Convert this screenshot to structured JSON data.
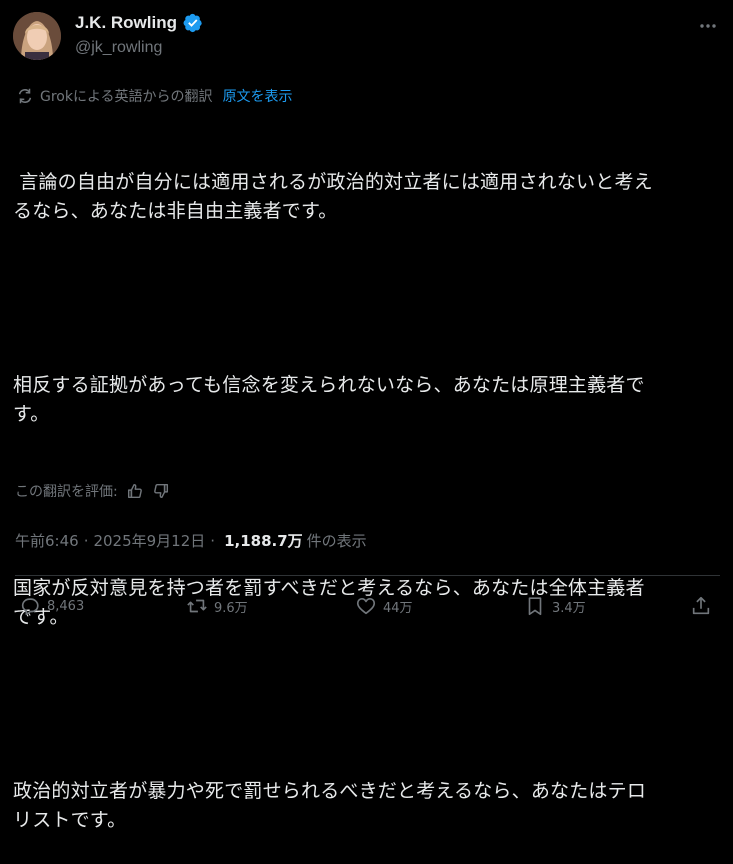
{
  "author": {
    "display_name": "J.K. Rowling",
    "handle": "@jk_rowling",
    "verified": true
  },
  "icons": {
    "more": "more-horizontal-icon",
    "translate": "translate-icon",
    "thumbs_up": "thumbs-up-icon",
    "thumbs_down": "thumbs-down-icon",
    "reply": "reply-icon",
    "repost": "repost-icon",
    "like": "like-icon",
    "bookmark": "bookmark-icon",
    "share": "share-icon"
  },
  "translation": {
    "label": "Grokによる英語からの翻訳",
    "show_original": "原文を表示"
  },
  "tweet": {
    "paragraphs": [
      " 言論の自由が自分には適用されるが政治的対立者には適用されないと考え\nるなら、あなたは非自由主義者です。",
      "相反する証拠があっても信念を変えられないなら、あなたは原理主義者で\nす。",
      "国家が反対意見を持つ者を罰すべきだと考えるなら、あなたは全体主義者\nです。",
      "政治的対立者が暴力や死で罰せられるべきだと考えるなら、あなたはテロ\nリストです。"
    ]
  },
  "rating": {
    "label": "この翻訳を評価:"
  },
  "meta": {
    "time": "午前6:46",
    "separator": "·",
    "date": "2025年9月12日",
    "views_count": "1,188.7万",
    "views_label": "件の表示"
  },
  "actions": {
    "replies": "8,463",
    "reposts": "9.6万",
    "likes": "44万",
    "bookmarks": "3.4万"
  },
  "colors": {
    "background": "#000000",
    "text": "#e7e9ea",
    "muted": "#71767b",
    "accent": "#1d9bf0",
    "divider": "#2f3336"
  }
}
